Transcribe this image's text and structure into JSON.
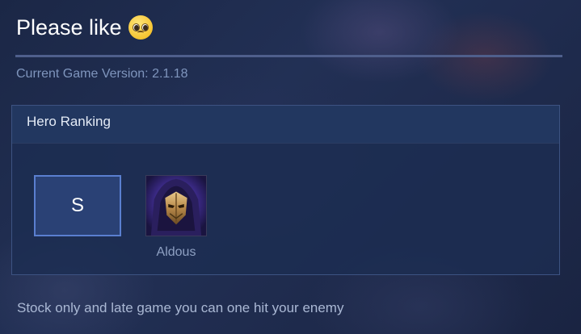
{
  "page": {
    "title": "Please like",
    "title_emoji": "pleading-face-emoji"
  },
  "version": {
    "text": "Current Game Version: 2.1.18"
  },
  "ranking": {
    "header": "Hero Ranking",
    "tier": "S",
    "heroes": [
      {
        "name": "Aldous",
        "portrait_icon": "aldous-portrait"
      }
    ]
  },
  "description": "Stock only and late game you can one hit your enemy",
  "colors": {
    "background": "#1a2440",
    "panel": "#1c2d52",
    "tier_border": "#5a7fd0",
    "tier_fill": "#2a4175",
    "version_text": "#7f95bd"
  }
}
